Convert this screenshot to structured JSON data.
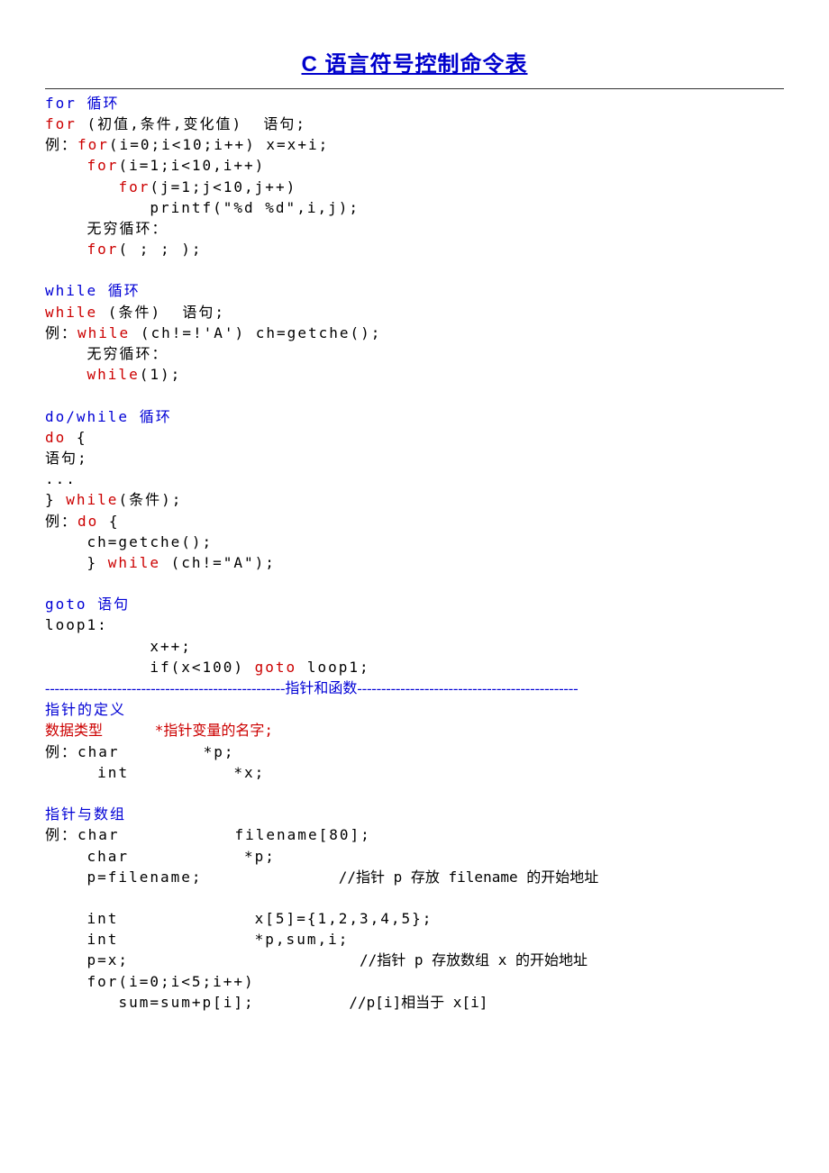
{
  "title": "C 语言符号控制命令表",
  "sections": {
    "for": {
      "heading": "for 循环",
      "syntax_kw": "for",
      "syntax_rest": " (初值,条件,变化值)  语句;",
      "ex_label": "例：",
      "ex1_kw": "for",
      "ex1_rest": "(i=0;i<10;i++) x=x+i;",
      "ex2_kw": "for",
      "ex2_rest": "(i=1;i<10,i++)",
      "ex3_kw": "for",
      "ex3_rest": "(j=1;j<10,j++)",
      "ex4": "printf(\"%d %d\",i,j);",
      "inf_label": "无穷循环：",
      "inf_kw": "for",
      "inf_rest": "( ; ; );"
    },
    "while": {
      "heading": "while 循环",
      "syntax_kw": "while",
      "syntax_rest": " (条件)  语句;",
      "ex_label": "例：",
      "ex1_kw": "while",
      "ex1_rest": " (ch!=!'A') ch=getche();",
      "inf_label": "无穷循环：",
      "inf_kw": "while",
      "inf_rest": "(1);"
    },
    "dowhile": {
      "heading": "do/while 循环",
      "kw_do": "do",
      "brace_open": " {",
      "stmt": "语句;",
      "dots": "...",
      "brace_close": "} ",
      "kw_while": "while",
      "cond": "(条件);",
      "ex_label": "例：",
      "ex_do": "do",
      "ex_brace": " {",
      "ex_body": "ch=getche();",
      "ex_close": "} ",
      "ex_while": "while",
      "ex_cond": " (ch!=\"A\");"
    },
    "goto": {
      "heading": "goto 语句",
      "l1": "loop1:",
      "l2": "x++;",
      "l3a": "if(x<100) ",
      "l3_kw": "goto",
      "l3b": " loop1;"
    },
    "divider": {
      "dashL": "--------------------------------------------------",
      "label": "指针和函数",
      "dashR": "----------------------------------------------"
    },
    "ptrdef": {
      "heading": "指针的定义",
      "syntax": "数据类型      *指针变量的名字;",
      "ex_label": "例：",
      "ex1": "char        *p;",
      "ex2": "int          *x;"
    },
    "ptrarr": {
      "heading": "指针与数组",
      "ex_label": "例：",
      "l1": "char           filename[80];",
      "l2": "char           *p;",
      "l3a": "p=filename;",
      "l3c": "//指针 p 存放 filename 的开始地址",
      "l4": "int             x[5]={1,2,3,4,5};",
      "l5": "int             *p,sum,i;",
      "l6a": "p=x;",
      "l6c": "//指针 p 存放数组 x 的开始地址",
      "l7": "for(i=0;i<5;i++)",
      "l8a": "sum=sum+p[i];",
      "l8c": "//p[i]相当于 x[i]"
    }
  }
}
